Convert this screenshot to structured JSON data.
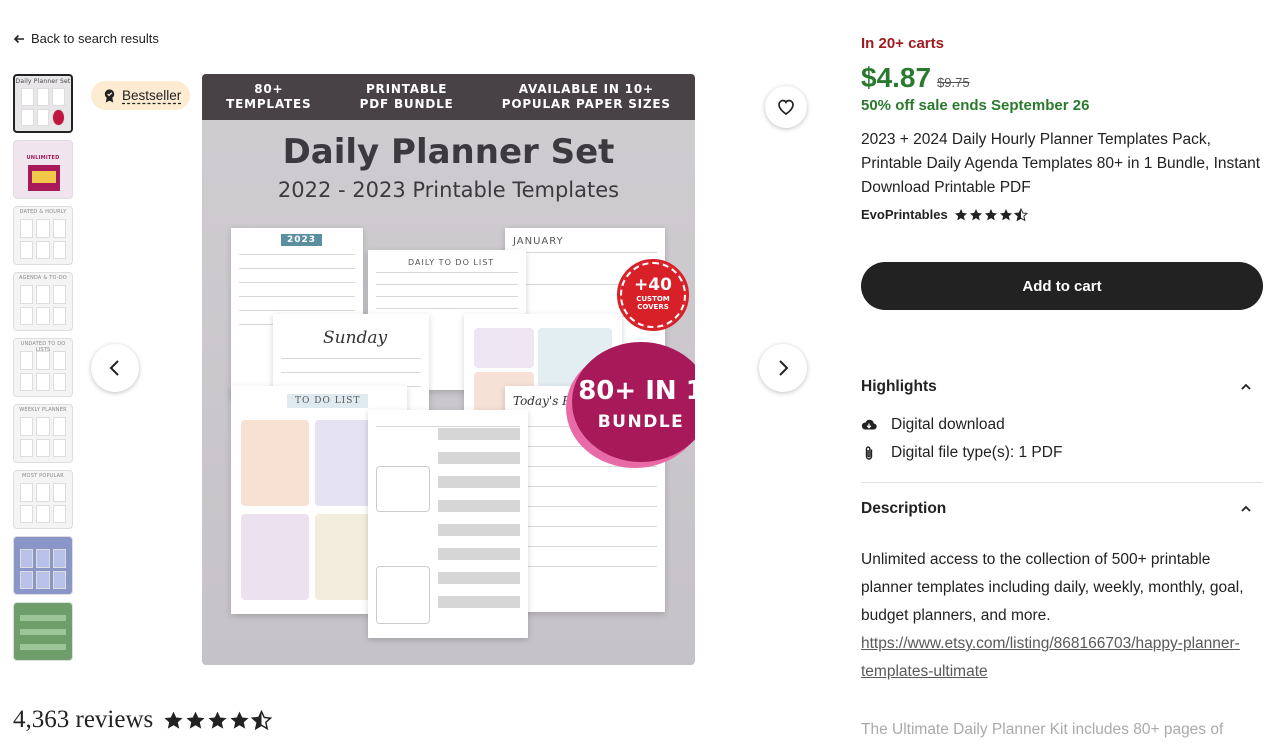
{
  "nav": {
    "back_label": "Back to search results"
  },
  "gallery": {
    "badge_label": "Bestseller",
    "thumbnails": [
      {
        "label": "Daily Planner Set",
        "color": "#e9e6ea"
      },
      {
        "label": "UNLIMITED",
        "color": "#f0e4ee"
      },
      {
        "label": "DATED & HOURLY",
        "color": "#efefef"
      },
      {
        "label": "AGENDA & TO-DO",
        "color": "#efefef"
      },
      {
        "label": "UNDATED TO DO LISTS",
        "color": "#efefef"
      },
      {
        "label": "WEEKLY PLANNER",
        "color": "#efefef"
      },
      {
        "label": "MOST POPULAR",
        "color": "#efefef"
      },
      {
        "label": "",
        "color": "#8a95c8"
      },
      {
        "label": "",
        "color": "#6e9f6a"
      }
    ],
    "main_image": {
      "banner": [
        "80+\nTEMPLATES",
        "PRINTABLE\nPDF BUNDLE",
        "AVAILABLE IN 10+\nPOPULAR PAPER SIZES"
      ],
      "title": "Daily Planner Set",
      "subtitle": "2022 - 2023 Printable Templates",
      "sticker_big": "+40",
      "sticker_small": "CUSTOM\nCOVERS",
      "bundle_line1": "80+ IN 1",
      "bundle_line2": "BUNDLE",
      "sheet_labels": {
        "calendar_year": "2023",
        "todo": "DAILY TO DO LIST",
        "january": "JANUARY",
        "sunday": "Sunday",
        "to_do_list": "TO DO LIST",
        "today": "Today's Plan"
      }
    }
  },
  "reviews": {
    "count_label": "4,363 reviews",
    "rating": 4.5
  },
  "product": {
    "carts_label": "In 20+ carts",
    "price": "$4.87",
    "original_price": "$9.75",
    "sale_label": "50% off sale ends September 26",
    "title": "2023 + 2024 Daily Hourly Planner Templates Pack, Printable Daily Agenda Templates 80+ in 1 Bundle, Instant Download Printable PDF",
    "shop_name": "EvoPrintables",
    "shop_rating": 4.5,
    "add_to_cart_label": "Add to cart"
  },
  "highlights": {
    "heading": "Highlights",
    "items": [
      {
        "icon": "cloud-download-icon",
        "label": "Digital download"
      },
      {
        "icon": "paperclip-icon",
        "label": "Digital file type(s): 1 PDF"
      }
    ]
  },
  "description": {
    "heading": "Description",
    "text": "Unlimited access to the collection of 500+ printable planner templates including daily, weekly, monthly, goal, budget planners, and more.",
    "link": "https://www.etsy.com/listing/868166703/happy-planner-templates-ultimate",
    "faded_text": "The Ultimate Daily Planner Kit includes 80+ pages of"
  },
  "colors": {
    "price_green": "#2a7a2e",
    "carts_red": "#9e1c20",
    "badge_bg": "#fdebd2",
    "bundle_magenta": "#a8195a"
  }
}
